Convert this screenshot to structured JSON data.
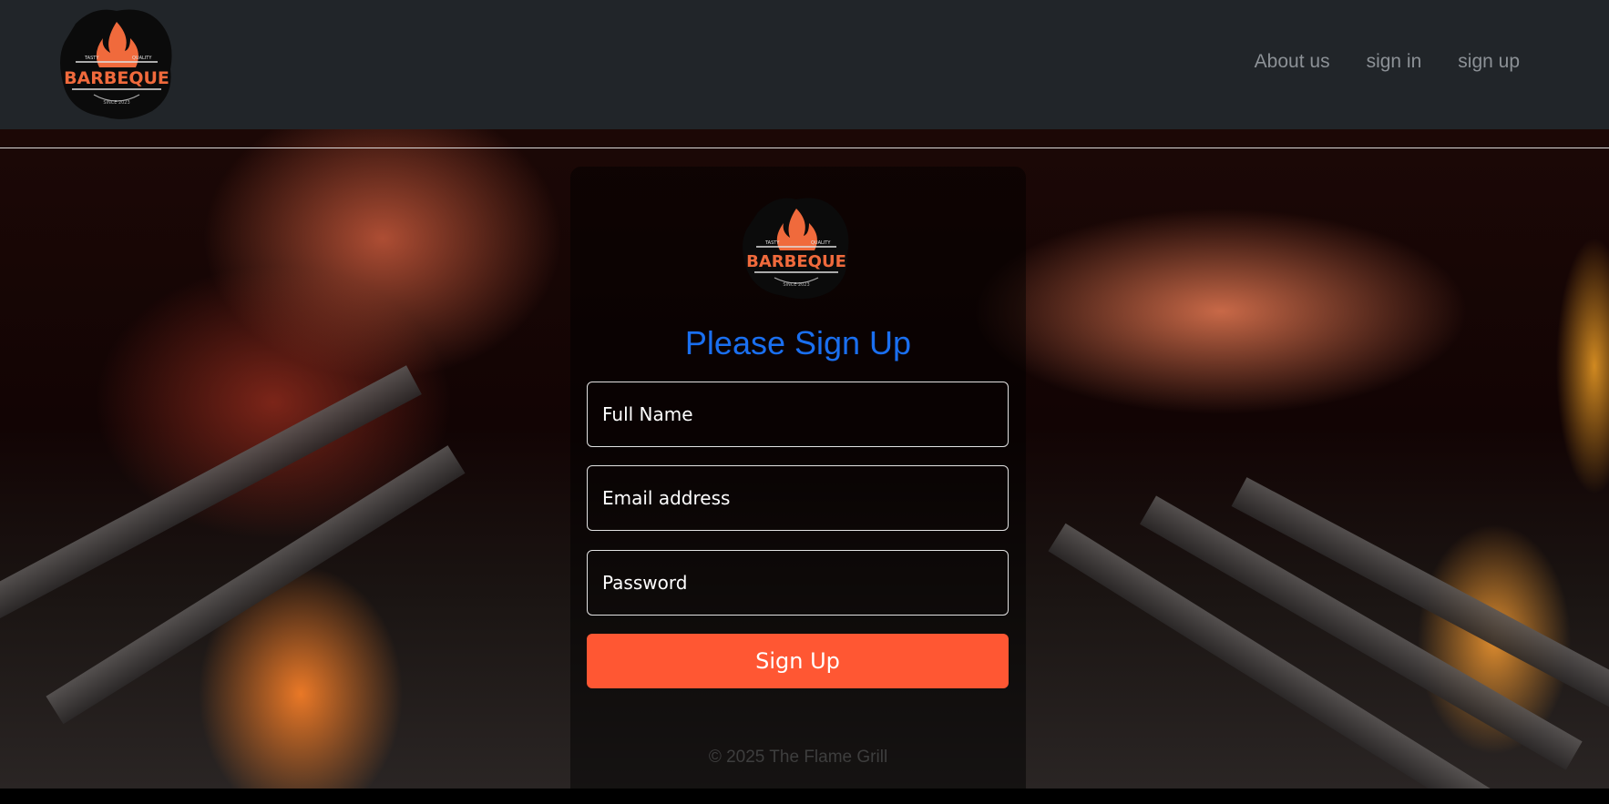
{
  "brand": {
    "logo_top_text_left": "TASTY",
    "logo_top_text_right": "QUALITY",
    "logo_text": "BARBEQUE",
    "logo_bottom_text": "SINCE 2023"
  },
  "nav": {
    "items": [
      {
        "label": "About us"
      },
      {
        "label": "sign in"
      },
      {
        "label": "sign up"
      }
    ]
  },
  "signup": {
    "title": "Please Sign Up",
    "fields": [
      {
        "placeholder": "Full Name"
      },
      {
        "placeholder": "Email address"
      },
      {
        "placeholder": "Password"
      }
    ],
    "submit_label": "Sign Up"
  },
  "footer": {
    "text": "© 2025 The Flame Grill"
  },
  "colors": {
    "navbar_bg": "#212529",
    "nav_link": "#8c9196",
    "title": "#1a6ff0",
    "submit_bg": "#ff5733"
  },
  "icons": {
    "brand_logo": "barbeque-logo-icon",
    "panel_logo": "barbeque-logo-icon"
  }
}
